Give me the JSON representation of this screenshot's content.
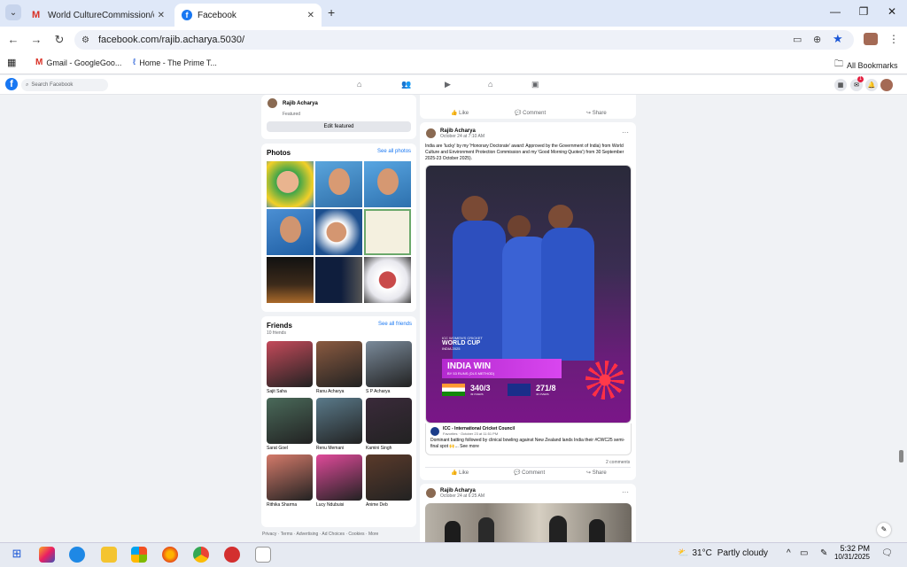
{
  "browser": {
    "tabs": [
      {
        "label": "World CultureCommission/depa",
        "icon": "gmail-icon"
      },
      {
        "label": "Facebook",
        "icon": "facebook-icon"
      }
    ],
    "url": "facebook.com/rajib.acharya.5030/",
    "bookmarks": [
      {
        "label": "Gmail - GoogleGoo..."
      },
      {
        "label": "Home - The Prime T..."
      }
    ],
    "all_bookmarks": "All Bookmarks"
  },
  "facebook": {
    "search_placeholder": "Search Facebook",
    "profile_name": "Rajib Acharya",
    "featured_label": "Featured",
    "edit_featured": "Edit featured",
    "photos": {
      "title": "Photos",
      "see_all": "See all photos"
    },
    "friends": {
      "title": "Friends",
      "count": "10 friends",
      "see_all": "See all friends",
      "list": [
        "Sajit Saha",
        "Ranu Acharya",
        "S P Acharya",
        "Sarat Goel",
        "Renu Memani",
        "Kamini Singh",
        "Rithika Sharma",
        "Lucy Ndubuisi",
        "Anime Deb"
      ]
    },
    "footer": "Privacy · Terms · Advertising · Ad Choices · Cookies · More",
    "actions": {
      "like": "Like",
      "comment": "Comment",
      "share": "Share"
    },
    "post1": {
      "author": "Rajib Acharya",
      "time": "October 24 at 7:10 AM",
      "text": "India are 'lucky' by my 'Honorary Doctorate' award: Approved by the Government of India) from World Culture and Environment Protection Commission and my 'Good Morning Quotes') from 30 September 2025-23 October 2025).",
      "image": {
        "banner": "INDIA WIN",
        "sub": "BY 53 RUNS (DLS METHOD)",
        "logo_top": "ICC WOMEN'S CRICKET",
        "logo_main": "WORLD CUP",
        "logo_sub": "INDIA 2025",
        "team1_score": "340/3",
        "team1_overs": "49 OVERS",
        "team2_score": "271/8",
        "team2_overs": "44 OVERS"
      },
      "shared_from": "ICC - International Cricket Council",
      "shared_meta": "Favorites · October 23 at 11:51 PM",
      "shared_text": "Dominant batting followed by clinical bowling against New Zealand lands India their #CWC25 semi-final spot 🙌... See more",
      "comments": "2 comments"
    },
    "post2": {
      "author": "Rajib Acharya",
      "time": "October 24 at 6:25 AM"
    }
  },
  "taskbar": {
    "weather_temp": "31°C",
    "weather_text": "Partly cloudy",
    "time": "5:32 PM",
    "date": "10/31/2025"
  }
}
